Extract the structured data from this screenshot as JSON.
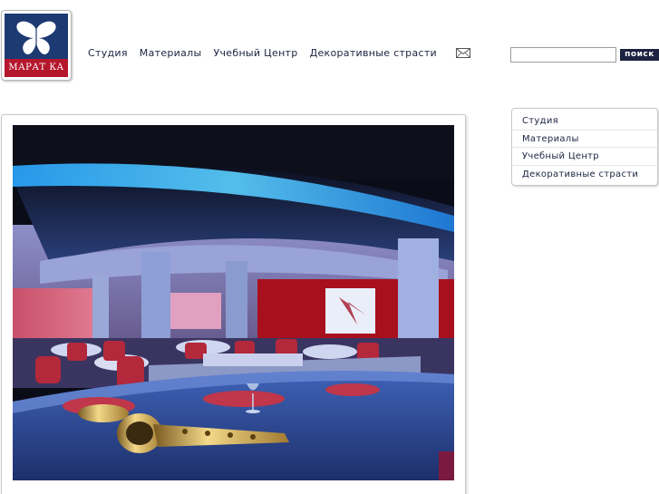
{
  "logo": {
    "text": "МАРАТ КА",
    "icon": "butterfly-icon"
  },
  "nav": {
    "items": [
      {
        "label": "Студия"
      },
      {
        "label": "Материалы"
      },
      {
        "label": "Учебный Центр"
      },
      {
        "label": "Декоративные страсти"
      }
    ]
  },
  "mail": {
    "icon": "mail-icon"
  },
  "search": {
    "value": "",
    "button_label": "поиск"
  },
  "side_menu": {
    "items": [
      {
        "label": "Студия"
      },
      {
        "label": "Материалы"
      },
      {
        "label": "Учебный Центр"
      },
      {
        "label": "Декоративные страсти"
      }
    ]
  },
  "colors": {
    "brand_blue": "#1d3a72",
    "brand_red": "#b5172d",
    "text_dark": "#1c2340"
  }
}
